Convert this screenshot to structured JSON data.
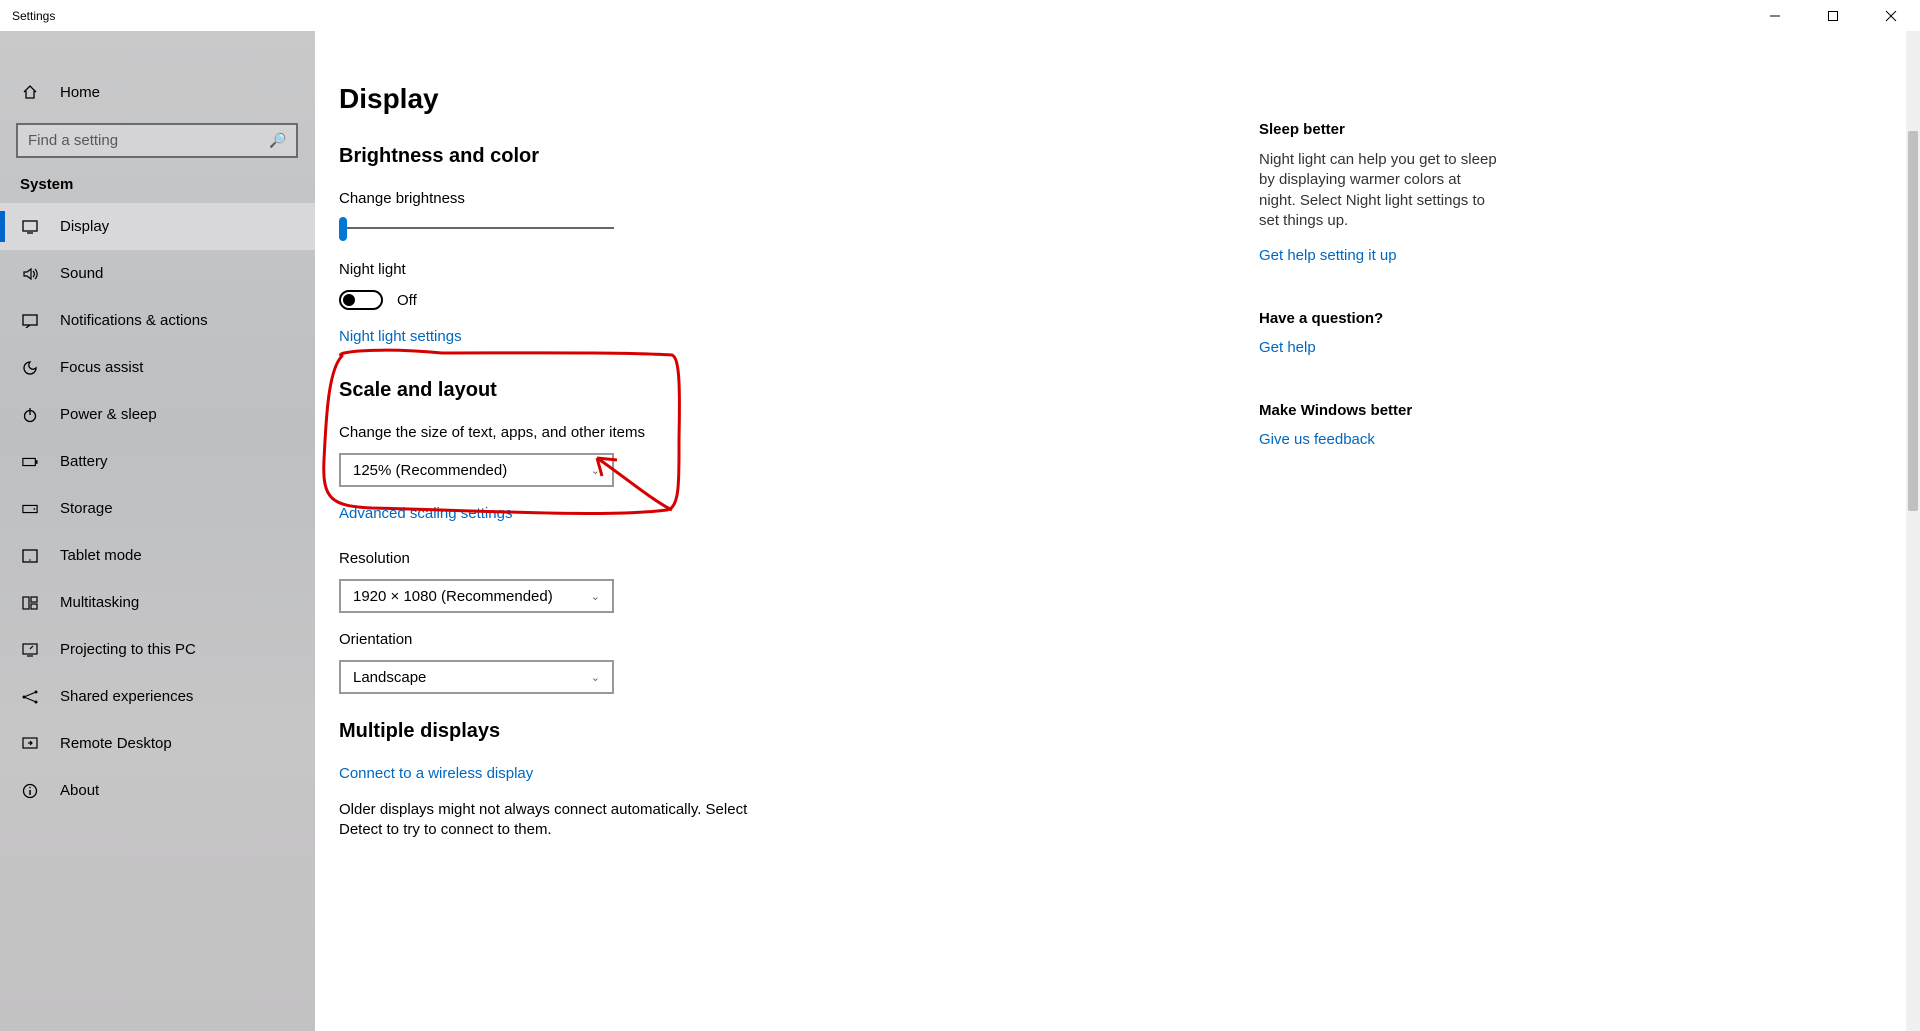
{
  "window": {
    "title": "Settings"
  },
  "sidebar": {
    "home": "Home",
    "search_placeholder": "Find a setting",
    "group": "System",
    "items": [
      {
        "label": "Display"
      },
      {
        "label": "Sound"
      },
      {
        "label": "Notifications & actions"
      },
      {
        "label": "Focus assist"
      },
      {
        "label": "Power & sleep"
      },
      {
        "label": "Battery"
      },
      {
        "label": "Storage"
      },
      {
        "label": "Tablet mode"
      },
      {
        "label": "Multitasking"
      },
      {
        "label": "Projecting to this PC"
      },
      {
        "label": "Shared experiences"
      },
      {
        "label": "Remote Desktop"
      },
      {
        "label": "About"
      }
    ]
  },
  "page": {
    "title": "Display",
    "brightness_section": "Brightness and color",
    "change_brightness": "Change brightness",
    "night_light_label": "Night light",
    "night_light_state": "Off",
    "night_light_link": "Night light settings",
    "scale_section": "Scale and layout",
    "scale_label": "Change the size of text, apps, and other items",
    "scale_value": "125% (Recommended)",
    "adv_scaling_link": "Advanced scaling settings",
    "resolution_label": "Resolution",
    "resolution_value": "1920 × 1080 (Recommended)",
    "orientation_label": "Orientation",
    "orientation_value": "Landscape",
    "multi_section": "Multiple displays",
    "wireless_link": "Connect to a wireless display",
    "older_displays": "Older displays might not always connect automatically. Select Detect to try to connect to them."
  },
  "right": {
    "sleep_h": "Sleep better",
    "sleep_p": "Night light can help you get to sleep by displaying warmer colors at night. Select Night light settings to set things up.",
    "sleep_link": "Get help setting it up",
    "q_h": "Have a question?",
    "q_link": "Get help",
    "fb_h": "Make Windows better",
    "fb_link": "Give us feedback"
  }
}
